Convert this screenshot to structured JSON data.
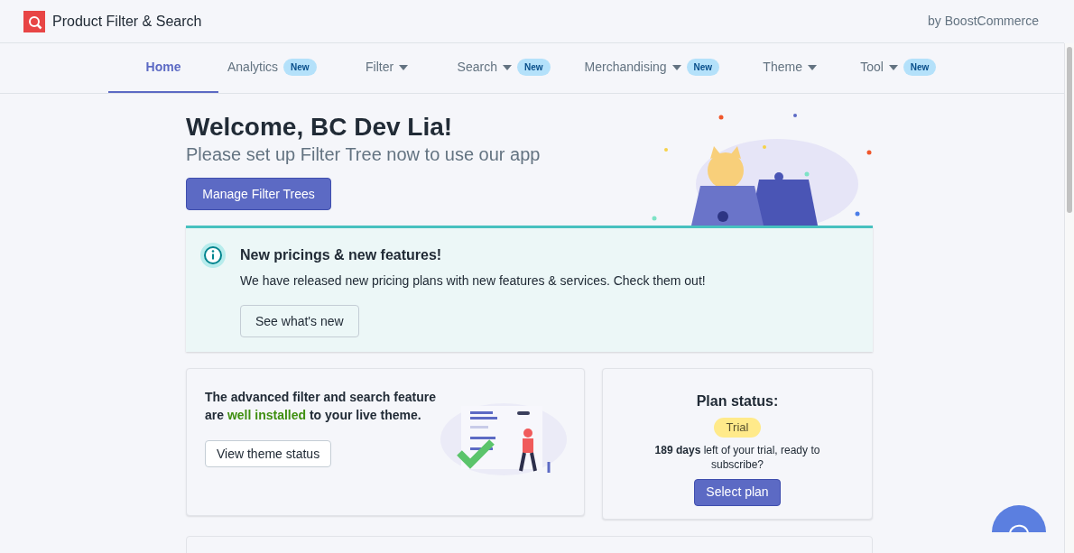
{
  "header": {
    "app_title": "Product Filter & Search",
    "vendor": "by BoostCommerce"
  },
  "nav": [
    {
      "label": "Home",
      "selected": true,
      "dropdown": false
    },
    {
      "label": "Analytics",
      "selected": false,
      "dropdown": false,
      "badge": "New"
    },
    {
      "label": "Filter",
      "selected": false,
      "dropdown": true
    },
    {
      "label": "Search",
      "selected": false,
      "dropdown": true,
      "badge": "New"
    },
    {
      "label": "Merchandising",
      "selected": false,
      "dropdown": true,
      "badge": "New"
    },
    {
      "label": "Theme",
      "selected": false,
      "dropdown": true
    },
    {
      "label": "Tool",
      "selected": false,
      "dropdown": true,
      "badge": "New"
    }
  ],
  "welcome": {
    "title": "Welcome, BC Dev Lia!",
    "subtitle": "Please set up Filter Tree now to use our app",
    "button": "Manage Filter Trees"
  },
  "banner": {
    "title": "New pricings & new features!",
    "text": "We have released new pricing plans with new features & services. Check them out!",
    "button": "See what's new"
  },
  "theme_card": {
    "parts": [
      {
        "kind": "plain",
        "text": "The advanced filter and search feature are "
      },
      {
        "kind": "highlight",
        "text": "well installed"
      },
      {
        "kind": "plain",
        "text": " to your live theme."
      }
    ],
    "button": "View theme status"
  },
  "plan_card": {
    "title": "Plan status:",
    "badge": "Trial",
    "text": "**189 days** left of your trial, ready to subscribe?",
    "button": "Select plan"
  }
}
